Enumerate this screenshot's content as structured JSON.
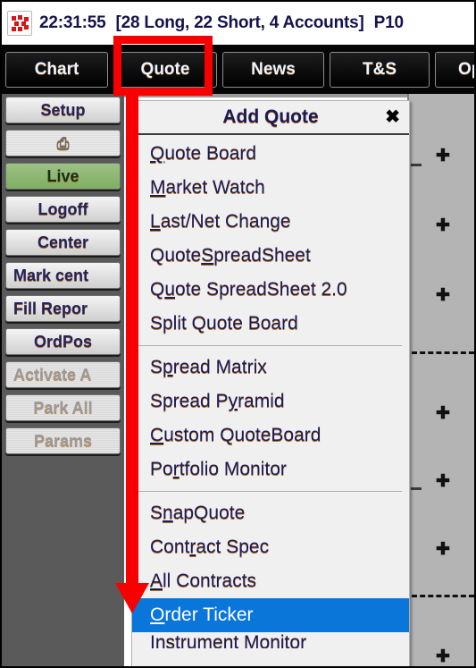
{
  "window": {
    "title_time": "22:31:55",
    "title_positions": "[28 Long, 22 Short, 4 Accounts]",
    "title_account": "P10",
    "logo_icon": "scatter-dots-logo"
  },
  "toolbar": {
    "buttons": [
      {
        "label": "Chart"
      },
      {
        "label": "Quote"
      },
      {
        "label": "News"
      },
      {
        "label": "T&S"
      },
      {
        "label": "Opti"
      }
    ]
  },
  "sidebar": {
    "buttons": [
      {
        "label": "Setup",
        "state": "enabled"
      },
      {
        "label": "",
        "icon": "printer-icon",
        "state": "enabled"
      },
      {
        "label": "Live",
        "state": "active"
      },
      {
        "label": "Logoff",
        "state": "enabled"
      },
      {
        "label": "Center",
        "state": "enabled"
      },
      {
        "label": "Mark cent",
        "state": "enabled"
      },
      {
        "label": "Fill Repor",
        "state": "enabled"
      },
      {
        "label": "OrdPos",
        "state": "enabled"
      },
      {
        "label": "Activate A",
        "state": "disabled"
      },
      {
        "label": "Park All",
        "state": "disabled"
      },
      {
        "label": "Params",
        "state": "disabled"
      }
    ],
    "printer_glyph": "⎙"
  },
  "menu": {
    "title": "Add Quote",
    "close_label": "✖",
    "groups": [
      {
        "items": [
          {
            "pre": "",
            "mnemonic": "Q",
            "post": "uote Board"
          },
          {
            "pre": "",
            "mnemonic": "M",
            "post": "arket Watch"
          },
          {
            "pre": "",
            "mnemonic": "L",
            "post": "ast/Net Change"
          },
          {
            "pre": "Quote ",
            "mnemonic": "S",
            "post": "preadSheet"
          },
          {
            "pre": "Q",
            "mnemonic": "u",
            "post": "ote SpreadSheet 2.0"
          },
          {
            "pre": "Split Quote Board",
            "mnemonic": "",
            "post": ""
          }
        ]
      },
      {
        "items": [
          {
            "pre": "S",
            "mnemonic": "p",
            "post": "read Matrix"
          },
          {
            "pre": "Spread P",
            "mnemonic": "y",
            "post": "ramid"
          },
          {
            "pre": "",
            "mnemonic": "C",
            "post": "ustom QuoteBoard"
          },
          {
            "pre": "Po",
            "mnemonic": "r",
            "post": "tfolio Monitor"
          }
        ]
      },
      {
        "items": [
          {
            "pre": "S",
            "mnemonic": "n",
            "post": "apQuote"
          },
          {
            "pre": "Cont",
            "mnemonic": "r",
            "post": "act Spec"
          },
          {
            "pre": "",
            "mnemonic": "A",
            "post": "ll Contracts"
          },
          {
            "pre": "",
            "mnemonic": "O",
            "post": "rder Ticker",
            "selected": true
          },
          {
            "pre": "Instrument Monitor",
            "mnemonic": "",
            "post": "",
            "clipped": true
          }
        ]
      }
    ]
  },
  "annotation": {
    "highlight_target": "Quote",
    "arrow_target": "Order Ticker",
    "color": "#f90000"
  },
  "grid_panel": {
    "plus_glyph": "✚",
    "plus_rows": [
      60,
      138,
      216,
      348,
      424,
      500,
      620
    ],
    "dashed_rules": [
      288,
      560
    ],
    "tick_marks": [
      78,
      440
    ]
  },
  "colors": {
    "accent_red": "#f90000",
    "selection_blue": "#0b76d9",
    "live_green": "#7fae63",
    "menu_bg": "#f0f0f0",
    "toolbar_bg": "#050505",
    "workspace_gray": "#5a5a5a"
  }
}
